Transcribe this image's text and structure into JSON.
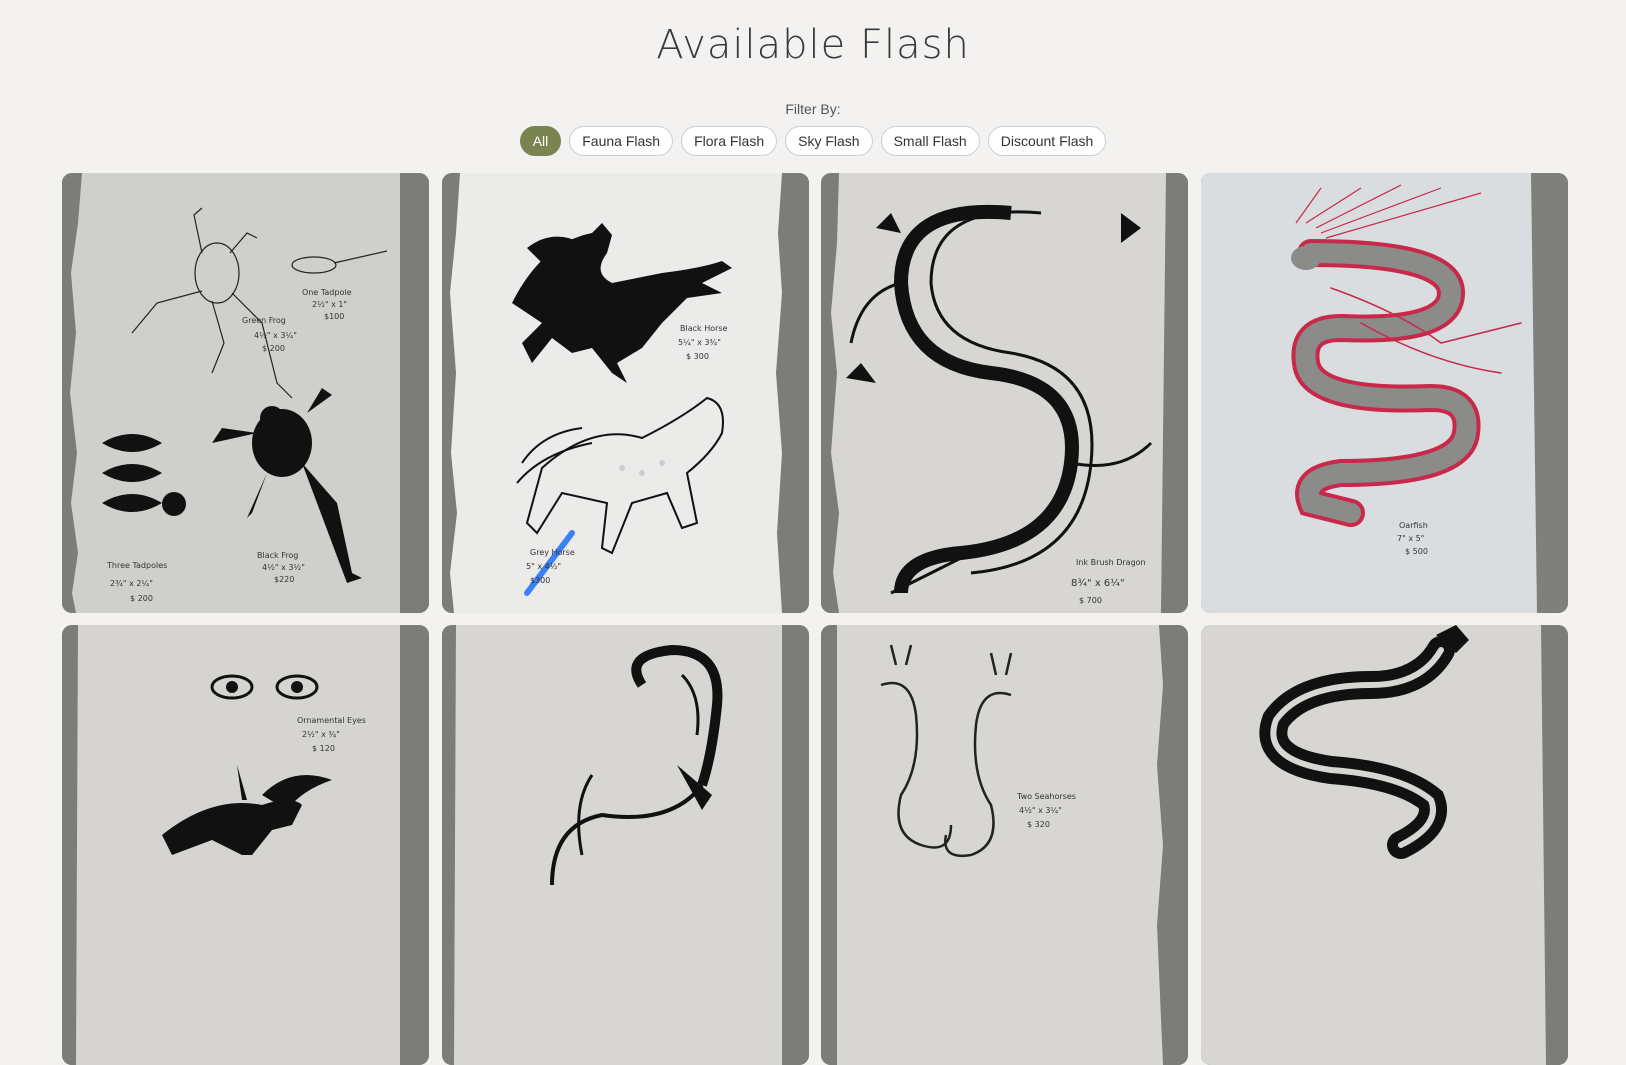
{
  "page": {
    "title": "Available Flash"
  },
  "filter": {
    "label": "Filter By:",
    "options": [
      "All",
      "Fauna Flash",
      "Flora Flash",
      "Sky Flash",
      "Small Flash",
      "Discount Flash"
    ],
    "selected": "All"
  },
  "colors": {
    "accent": "#7a8450",
    "background": "#f3f2f0",
    "ink": "#111111",
    "oarfish_red": "#c8284a",
    "marker_blue": "#3b82f6"
  },
  "gallery": {
    "items": [
      {
        "icon": "frog-flash-sheet",
        "captions": [
          "Green Frog",
          "4½\" x 3¼\"",
          "$ 200",
          "One Tadpole",
          "2½\" x 1\"",
          "$100",
          "Black Frog",
          "4½\" x 3½\"",
          "$220",
          "Three Tadpoles",
          "2¾\" x 2¼\"",
          "$ 200"
        ]
      },
      {
        "icon": "horse-flash-sheet",
        "captions": [
          "Black Horse",
          "5¼\" x 3¾\"",
          "$ 300",
          "Grey Horse",
          "5\" x 4½\"",
          "$300"
        ]
      },
      {
        "icon": "dragon-flash-sheet",
        "captions": [
          "Ink Brush Dragon",
          "8¾\" x 6¼\"",
          "$ 700"
        ]
      },
      {
        "icon": "oarfish-flash-sheet",
        "captions": [
          "Oarfish",
          "7\" x 5\"",
          "$ 500"
        ]
      },
      {
        "icon": "eyes-unicorn-flash-sheet",
        "captions": [
          "Ornamental Eyes",
          "2½\" x ¾\"",
          "$ 120"
        ]
      },
      {
        "icon": "tiger-dragon-flash-sheet",
        "captions": []
      },
      {
        "icon": "seahorse-flash-sheet",
        "captions": [
          "Two Seahorses",
          "4½\" x 3¼\"",
          "$ 320"
        ]
      },
      {
        "icon": "serpent-flash-sheet",
        "captions": []
      }
    ]
  }
}
